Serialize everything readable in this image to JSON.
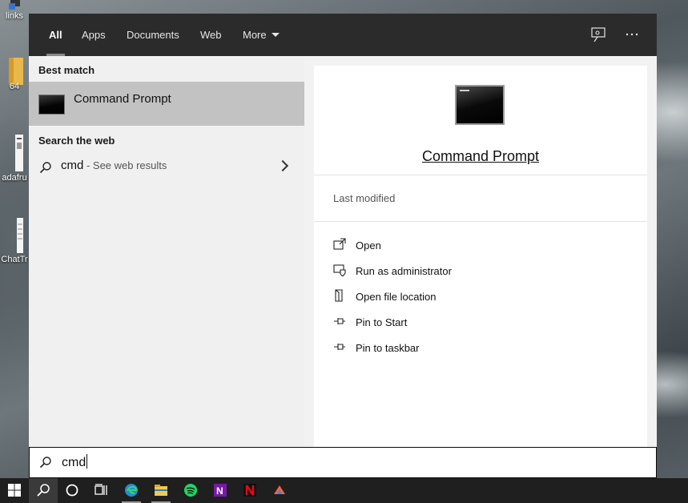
{
  "desktop": {
    "icons": [
      {
        "label": "links",
        "name": "desktop-icon-links"
      },
      {
        "label": "64",
        "name": "desktop-icon-folder"
      },
      {
        "label": "adafru",
        "name": "desktop-icon-adafruit"
      },
      {
        "label": "ChatTr",
        "name": "desktop-icon-chattr"
      }
    ]
  },
  "tabs": [
    {
      "label": "All",
      "active": true
    },
    {
      "label": "Apps"
    },
    {
      "label": "Documents"
    },
    {
      "label": "Web"
    },
    {
      "label": "More"
    }
  ],
  "topbar_icons": [
    "feedback-icon",
    "more-options-icon"
  ],
  "best_match": {
    "heading": "Best match",
    "title": "Command Prompt",
    "icon": "command-prompt-icon"
  },
  "web_search": {
    "heading": "Search the web",
    "query": "cmd",
    "suffix": " - See web results",
    "icon": "search-icon"
  },
  "preview": {
    "title": "Command Prompt",
    "last_modified_label": "Last modified",
    "actions": [
      {
        "label": "Open",
        "icon": "open-icon"
      },
      {
        "label": "Run as administrator",
        "icon": "run-as-admin-icon"
      },
      {
        "label": "Open file location",
        "icon": "file-location-icon"
      },
      {
        "label": "Pin to Start",
        "icon": "pin-icon"
      },
      {
        "label": "Pin to taskbar",
        "icon": "pin-icon"
      }
    ]
  },
  "search_box": {
    "value": "cmd",
    "icon": "search-icon"
  },
  "taskbar": {
    "items": [
      "start-icon",
      "search-icon",
      "cortana-icon",
      "task-view-icon",
      "edge-icon",
      "file-explorer-icon",
      "spotify-icon",
      "onenote-icon",
      "netflix-icon",
      "app-icon"
    ]
  },
  "colors": {
    "topbar": "#2b2b2b",
    "selected_row": "#c2c2c2",
    "taskbar": "#1f1f1f"
  }
}
